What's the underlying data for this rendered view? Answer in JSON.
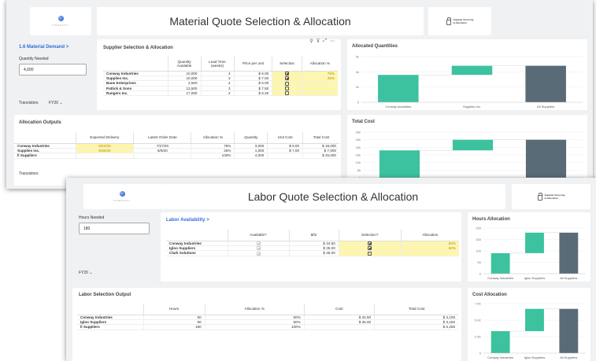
{
  "material": {
    "title": "Material Quote Selection & Allocation",
    "company": "COMPANY",
    "badge": [
      "Supplier Sourcing",
      "& Allocation"
    ],
    "demand_link": "1.6 Material Demand >",
    "qty_label": "Quantity Needed",
    "qty_value": "4,000",
    "part": "Transistors",
    "fy": "FY20 ⌄",
    "supplier_title": "Supplier Selection & Allocation",
    "toolbar": [
      "⚲",
      "⊽",
      "⤢",
      "⋯"
    ],
    "supplier_headers": [
      "Quantity Available",
      "Lead Time (weeks)",
      "Price per unit",
      "Selection",
      "Allocation %"
    ],
    "suppliers": [
      {
        "name": "Conway Industries",
        "qty": "10,000",
        "lead": "4",
        "price": "$ 6.00",
        "sel": true,
        "alloc": "75%"
      },
      {
        "name": "Supplies Inc.",
        "qty": "10,000",
        "lead": "3",
        "price": "$ 7.00",
        "sel": true,
        "alloc": "25%"
      },
      {
        "name": "Bane Enterprises",
        "qty": "2,500",
        "lead": "4",
        "price": "$ 6.00",
        "sel": false,
        "alloc": ""
      },
      {
        "name": "Pattick & Sons",
        "qty": "12,500",
        "lead": "3",
        "price": "$ 7.50",
        "sel": false,
        "alloc": ""
      },
      {
        "name": "Rangers Inc.",
        "qty": "17,000",
        "lead": "2",
        "price": "$ 6.25",
        "sel": false,
        "alloc": ""
      }
    ],
    "outputs_title": "Allocation Outputs",
    "outputs_headers": [
      "Expected Delivery",
      "Latest Order Date",
      "Allocation %",
      "Quantity",
      "Unit Cost",
      "Total Cost"
    ],
    "outputs": [
      {
        "name": "Conway Industries",
        "delivery": "8/24/20",
        "order": "7/27/20",
        "alloc": "75%",
        "qty": "3,000",
        "unit": "$ 6.00",
        "total": "$ 18,000"
      },
      {
        "name": "Supplies Inc.",
        "delivery": "8/30/20",
        "order": "8/9/20",
        "alloc": "25%",
        "qty": "1,000",
        "unit": "$ 7.00",
        "total": "$ 7,000"
      },
      {
        "name": "ll Suppliers",
        "delivery": "",
        "order": "",
        "alloc": "100%",
        "qty": "4,000",
        "unit": "",
        "total": "$ 25,000"
      }
    ],
    "part_bottom": "Transistors",
    "alloc_chart_title": "Allocated Quantities",
    "cost_chart_title": "Total Cost",
    "chart_cats": [
      "Conway Industries",
      "Supplies Inc.",
      "All Suppliers"
    ]
  },
  "labor": {
    "title": "Labor Quote Selection & Allocation",
    "company": "COMPANY",
    "badge": [
      "Supplier Sourcing",
      "& Allocation"
    ],
    "hours_label": "Hours Needed",
    "hours_value": "180",
    "fy": "FY20 ⌄",
    "avail_link": "Labor Availability >",
    "avail_headers": [
      "Available?",
      "$/hr",
      "Selection?",
      "Allocation"
    ],
    "avail": [
      {
        "name": "Conway Industries",
        "avail": true,
        "rate": "$ 34.50",
        "sel": true,
        "alloc": "50%"
      },
      {
        "name": "Igloo Suppliers",
        "avail": true,
        "rate": "$ 35.00",
        "sel": true,
        "alloc": "50%"
      },
      {
        "name": "Clark Solutions",
        "avail": true,
        "rate": "$ 35.00",
        "sel": false,
        "alloc": ""
      }
    ],
    "output_title": "Labor Selection Output",
    "output_headers": [
      "Hours",
      "Allocation %",
      "Cost",
      "Total Cost"
    ],
    "output": [
      {
        "name": "Conway Industries",
        "hours": "90",
        "alloc": "50%",
        "cost": "$ 34.50",
        "total": "$ 3,105"
      },
      {
        "name": "Igloo Suppliers",
        "hours": "90",
        "alloc": "50%",
        "cost": "$ 35.00",
        "total": "$ 3,150"
      },
      {
        "name": "ll Suppliers",
        "hours": "180",
        "alloc": "100%",
        "cost": "",
        "total": "$ 6,255"
      }
    ],
    "hours_chart_title": "Hours Allocation",
    "cost_chart_title": "Cost Allocation",
    "chart_cats": [
      "Conway Industries",
      "Igloo Suppliers",
      "All Suppliers"
    ]
  },
  "colors": {
    "green": "#3cc29f",
    "slate": "#5a6b78",
    "link": "#2f6fd6",
    "highlight": "#fff7a8"
  },
  "chart_data": [
    {
      "type": "bar",
      "title": "Allocated Quantities",
      "categories": [
        "Conway Industries",
        "Supplies Inc.",
        "All Suppliers"
      ],
      "values": [
        3000,
        1000,
        4000
      ],
      "waterfall": true,
      "ylim": [
        0,
        5000
      ],
      "yticks": [
        "0",
        "2k",
        "4k",
        "5k"
      ]
    },
    {
      "type": "bar",
      "title": "Total Cost",
      "categories": [
        "Conway Industries",
        "Supplies Inc.",
        "All Suppliers"
      ],
      "values": [
        18000,
        7000,
        25000
      ],
      "waterfall": true,
      "ylim": [
        0,
        30000
      ],
      "yticks": [
        "0",
        "5k",
        "10k",
        "15k",
        "20k",
        "25k",
        "30k"
      ]
    },
    {
      "type": "bar",
      "title": "Hours Allocation",
      "categories": [
        "Conway Industries",
        "Igloo Suppliers",
        "All Suppliers"
      ],
      "values": [
        90,
        90,
        180
      ],
      "waterfall": true,
      "ylim": [
        0,
        200
      ],
      "yticks": [
        "0",
        "50",
        "100",
        "150",
        "200"
      ]
    },
    {
      "type": "bar",
      "title": "Cost Allocation",
      "categories": [
        "Conway Industries",
        "Igloo Suppliers",
        "All Suppliers"
      ],
      "values": [
        3105,
        3150,
        6255
      ],
      "waterfall": true,
      "ylim": [
        0,
        7000
      ],
      "yticks": [
        "0",
        "2.5K",
        "5.0K",
        "7.5K"
      ]
    }
  ]
}
